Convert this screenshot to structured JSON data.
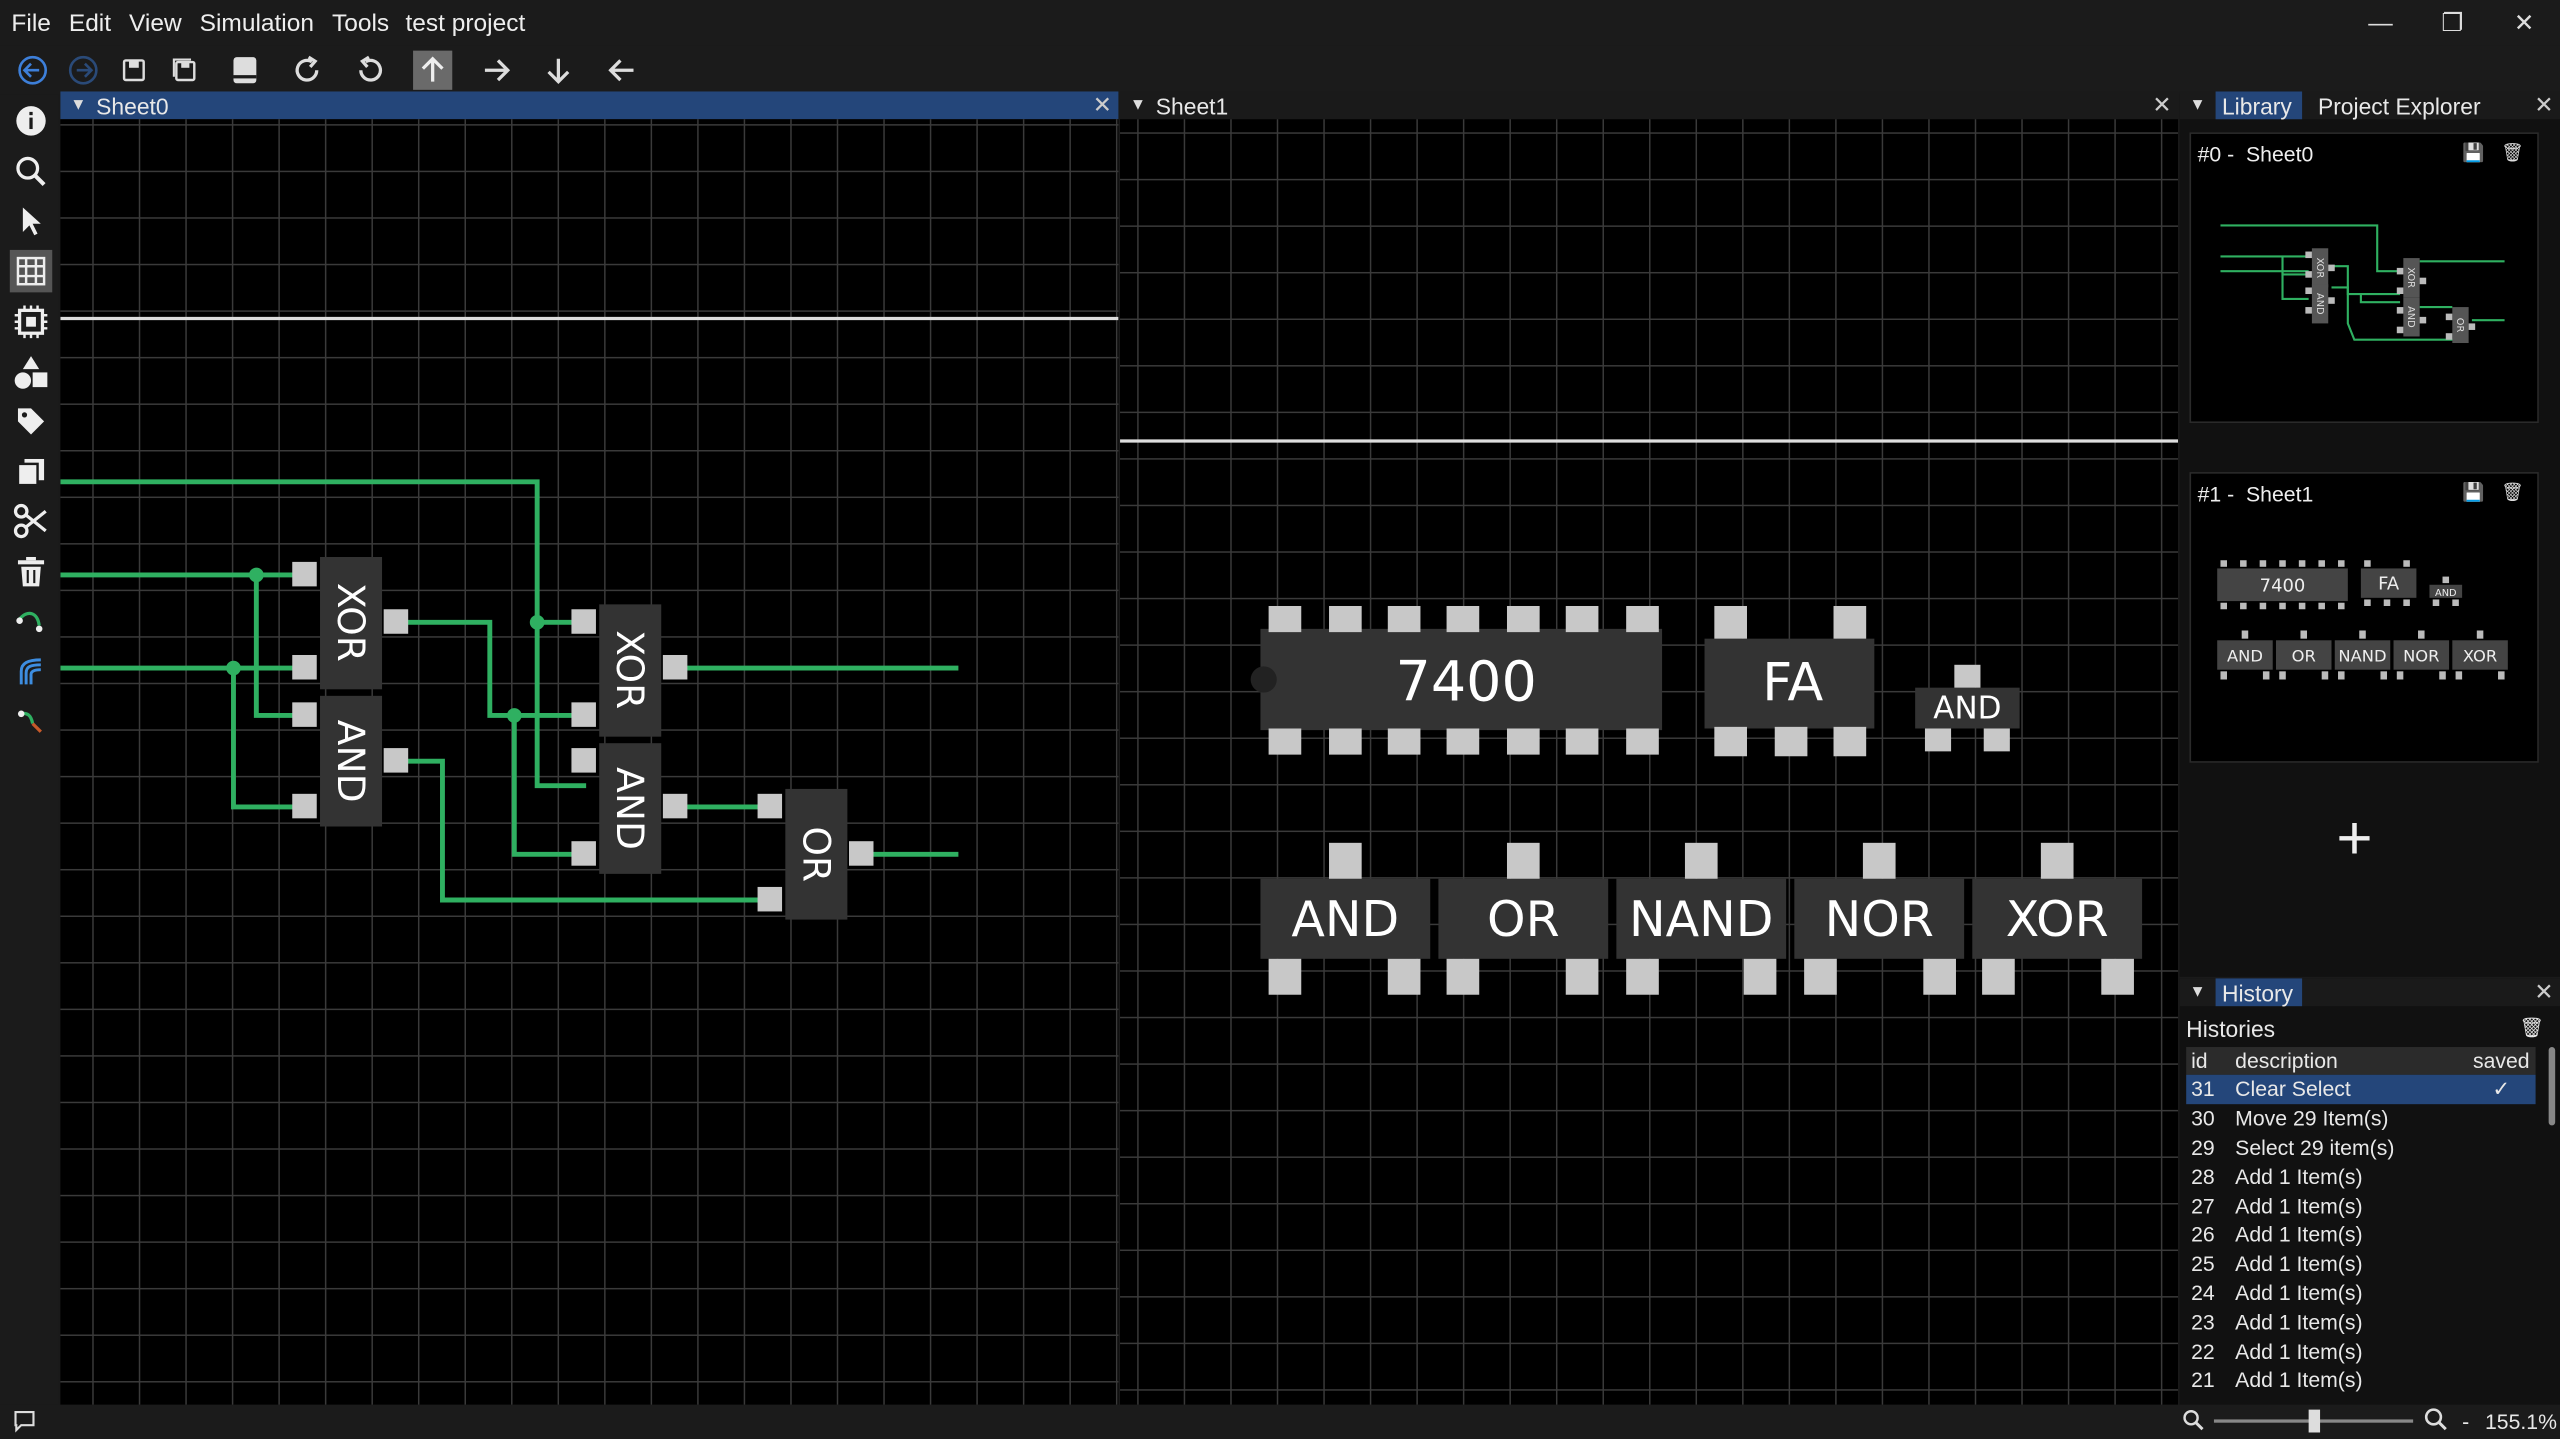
{
  "app": {
    "project_name": "test project",
    "menu": [
      "File",
      "Edit",
      "View",
      "Simulation",
      "Tools"
    ],
    "window_controls": [
      "—",
      "❐",
      "✕"
    ]
  },
  "toolbar": {
    "icons": [
      "back-icon",
      "forward-icon",
      "save-icon",
      "save-all-icon",
      "notebook-icon",
      "redo-icon",
      "undo-icon",
      "arrow-up-icon",
      "arrow-right-icon",
      "arrow-down-icon",
      "arrow-left-icon"
    ],
    "active": "arrow-up-icon"
  },
  "sidebar": {
    "icons": [
      "info-icon",
      "search-icon",
      "pointer-icon",
      "grid-icon",
      "chip-icon",
      "shapes-icon",
      "tag-icon",
      "copy-icon",
      "scissors-icon",
      "trash-icon",
      "wire-icon",
      "bus-icon",
      "probe-icon"
    ],
    "active": "grid-icon"
  },
  "sheets": [
    {
      "tab": "Sheet0",
      "active": true
    },
    {
      "tab": "Sheet1",
      "active": false
    }
  ],
  "sheet0": {
    "gates": [
      "XOR",
      "AND",
      "XOR",
      "AND",
      "OR"
    ]
  },
  "sheet1": {
    "chip_7400": "7400",
    "fa": "FA",
    "small_and": "AND",
    "gates": [
      "AND",
      "OR",
      "NAND",
      "NOR",
      "XOR"
    ]
  },
  "right_panel": {
    "tabs": [
      "Library",
      "Project Explorer"
    ],
    "cards": [
      {
        "prefix": "#0 -",
        "name": "Sheet0",
        "gates": [
          "XOR",
          "AND",
          "XOR",
          "AND",
          "OR"
        ]
      },
      {
        "prefix": "#1 -",
        "name": "Sheet1",
        "chip": "7400",
        "fa": "FA",
        "small": "AND",
        "gates": [
          "AND",
          "OR",
          "NAND",
          "NOR",
          "XOR"
        ]
      }
    ],
    "add_label": "+"
  },
  "history": {
    "panel_title": "History",
    "section": "Histories",
    "columns": [
      "id",
      "description",
      "saved"
    ],
    "rows": [
      {
        "id": "31",
        "desc": "Clear Select",
        "saved": "✓",
        "selected": true
      },
      {
        "id": "30",
        "desc": "Move 29 Item(s)",
        "saved": ""
      },
      {
        "id": "29",
        "desc": "Select 29 item(s)",
        "saved": ""
      },
      {
        "id": "28",
        "desc": "Add 1 Item(s)",
        "saved": ""
      },
      {
        "id": "27",
        "desc": "Add 1 Item(s)",
        "saved": ""
      },
      {
        "id": "26",
        "desc": "Add 1 Item(s)",
        "saved": ""
      },
      {
        "id": "25",
        "desc": "Add 1 Item(s)",
        "saved": ""
      },
      {
        "id": "24",
        "desc": "Add 1 Item(s)",
        "saved": ""
      },
      {
        "id": "23",
        "desc": "Add 1 Item(s)",
        "saved": ""
      },
      {
        "id": "22",
        "desc": "Add 1 Item(s)",
        "saved": ""
      },
      {
        "id": "21",
        "desc": "Add 1 Item(s)",
        "saved": ""
      }
    ]
  },
  "status": {
    "zoom_sep": "-",
    "zoom": "155.1%",
    "zoom_slider": 0.5
  },
  "colors": {
    "wire": "#2fb061",
    "gate": "#333333",
    "pin": "#c8c8c8",
    "accent": "#24467a"
  }
}
